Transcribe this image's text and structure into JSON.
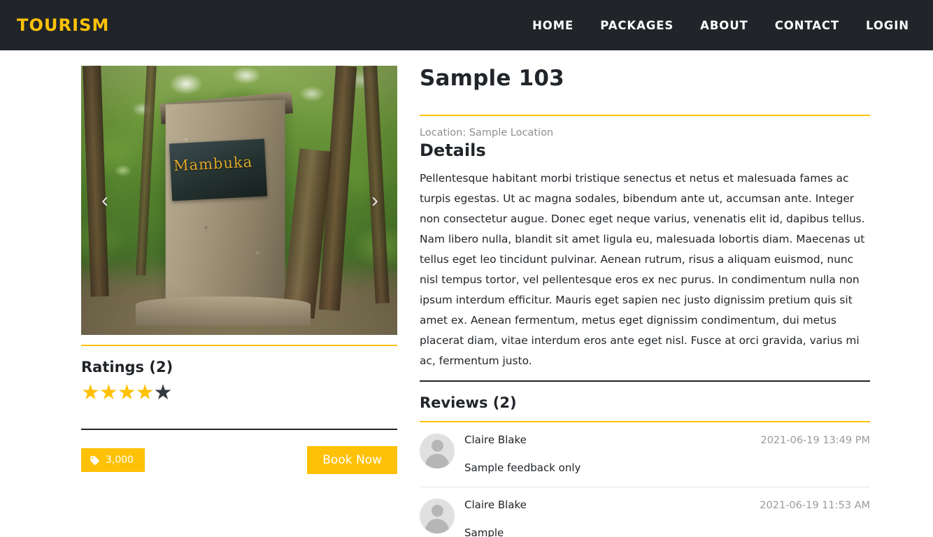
{
  "navbar": {
    "brand": "TOURISM",
    "links": [
      {
        "label": "HOME"
      },
      {
        "label": "PACKAGES"
      },
      {
        "label": "ABOUT"
      },
      {
        "label": "CONTACT"
      },
      {
        "label": "LOGIN"
      }
    ]
  },
  "colors": {
    "header_bg": "#212529",
    "accent": "#ffc107",
    "brand_text": "#ffc107",
    "muted_text": "#8e8e8e",
    "star_on": "#ffc107",
    "star_off": "#343a40"
  },
  "carousel": {
    "prev_label": "‹",
    "next_label": "›",
    "image_alt": "Mambuka stone monument in forest",
    "sign_text": "Mambuka"
  },
  "ratings": {
    "heading": "Ratings (2)",
    "count": 2,
    "stars_filled": 4,
    "stars_total": 5,
    "star_glyph": "★"
  },
  "actions": {
    "price_label": "3,000",
    "price_icon": "tag-icon",
    "book_label": "Book Now"
  },
  "detail": {
    "title": "Sample 103",
    "location": "Location: Sample Location",
    "details_heading": "Details",
    "details_body": "Pellentesque habitant morbi tristique senectus et netus et malesuada fames ac turpis egestas. Ut ac magna sodales, bibendum ante ut, accumsan ante. Integer non consectetur augue. Donec eget neque varius, venenatis elit id, dapibus tellus. Nam libero nulla, blandit sit amet ligula eu, malesuada lobortis diam. Maecenas ut tellus eget leo tincidunt pulvinar. Aenean rutrum, risus a aliquam euismod, nunc nisl tempus tortor, vel pellentesque eros ex nec purus. In condimentum nulla non ipsum interdum efficitur. Mauris eget sapien nec justo dignissim pretium quis sit amet ex. Aenean fermentum, metus eget dignissim condimentum, dui metus placerat diam, vitae interdum eros ante eget nisl. Fusce at orci gravida, varius mi ac, fermentum justo."
  },
  "reviews": {
    "heading": "Reviews (2)",
    "count": 2,
    "items": [
      {
        "name": "Claire Blake",
        "date": "2021-06-19 13:49 PM",
        "text": "Sample feedback only"
      },
      {
        "name": "Claire Blake",
        "date": "2021-06-19 11:53 AM",
        "text": "Sample"
      }
    ]
  }
}
